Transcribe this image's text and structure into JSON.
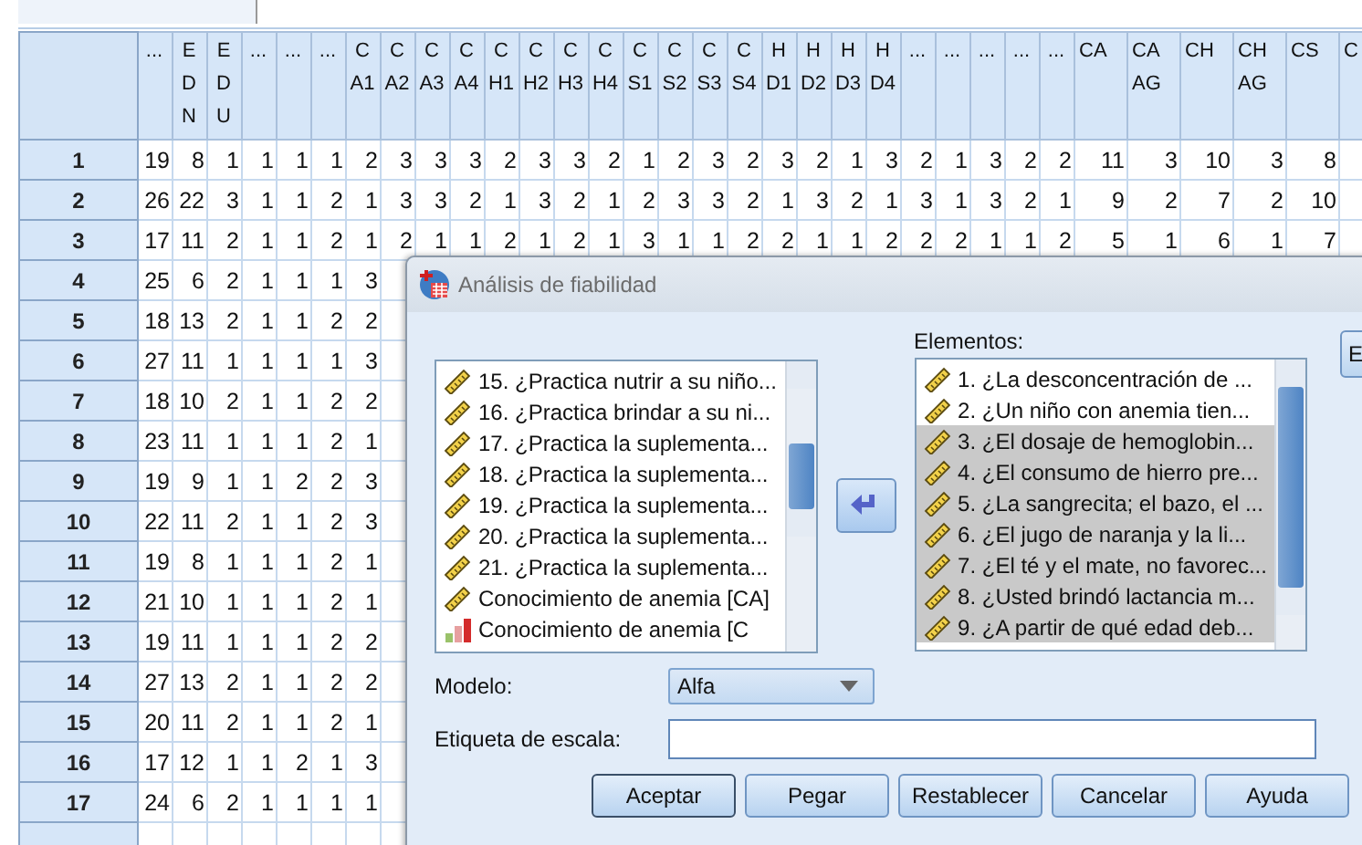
{
  "grid": {
    "columns": [
      {
        "label": "...",
        "kind": "narrow"
      },
      {
        "label": "EDN",
        "kind": "narrow"
      },
      {
        "label": "EDU",
        "kind": "narrow"
      },
      {
        "label": "...",
        "kind": "narrow"
      },
      {
        "label": "...",
        "kind": "narrow"
      },
      {
        "label": "...",
        "kind": "narrow"
      },
      {
        "label": "CA1",
        "kind": "narrow"
      },
      {
        "label": "CA2",
        "kind": "narrow"
      },
      {
        "label": "CA3",
        "kind": "narrow"
      },
      {
        "label": "CA4",
        "kind": "narrow"
      },
      {
        "label": "CH1",
        "kind": "narrow"
      },
      {
        "label": "CH2",
        "kind": "narrow"
      },
      {
        "label": "CH3",
        "kind": "narrow"
      },
      {
        "label": "CH4",
        "kind": "narrow"
      },
      {
        "label": "CS1",
        "kind": "narrow"
      },
      {
        "label": "CS2",
        "kind": "narrow"
      },
      {
        "label": "CS3",
        "kind": "narrow"
      },
      {
        "label": "CS4",
        "kind": "narrow"
      },
      {
        "label": "HD1",
        "kind": "narrow"
      },
      {
        "label": "HD2",
        "kind": "narrow"
      },
      {
        "label": "HD3",
        "kind": "narrow"
      },
      {
        "label": "HD4",
        "kind": "narrow"
      },
      {
        "label": "...",
        "kind": "narrow"
      },
      {
        "label": "...",
        "kind": "narrow"
      },
      {
        "label": "...",
        "kind": "narrow"
      },
      {
        "label": "...",
        "kind": "narrow"
      },
      {
        "label": "...",
        "kind": "narrow"
      },
      {
        "label": "CA",
        "kind": "wide"
      },
      {
        "label": "CAAG",
        "kind": "wide"
      },
      {
        "label": "CH",
        "kind": "wide"
      },
      {
        "label": "CHAG",
        "kind": "wide"
      },
      {
        "label": "CS",
        "kind": "wide"
      },
      {
        "label": "C",
        "kind": "wide"
      }
    ],
    "rows": [
      {
        "number": "1",
        "values": [
          "19",
          "8",
          "1",
          "1",
          "1",
          "1",
          "2",
          "3",
          "3",
          "3",
          "2",
          "3",
          "3",
          "2",
          "1",
          "2",
          "3",
          "2",
          "3",
          "2",
          "1",
          "3",
          "2",
          "1",
          "3",
          "2",
          "2",
          "11",
          "3",
          "10",
          "3",
          "8"
        ]
      },
      {
        "number": "2",
        "values": [
          "26",
          "22",
          "3",
          "1",
          "1",
          "2",
          "1",
          "3",
          "3",
          "2",
          "1",
          "3",
          "2",
          "1",
          "2",
          "3",
          "3",
          "2",
          "1",
          "3",
          "2",
          "1",
          "3",
          "1",
          "3",
          "2",
          "1",
          "9",
          "2",
          "7",
          "2",
          "10"
        ]
      },
      {
        "number": "3",
        "values": [
          "17",
          "11",
          "2",
          "1",
          "1",
          "2",
          "1",
          "2",
          "1",
          "1",
          "2",
          "1",
          "2",
          "1",
          "3",
          "1",
          "1",
          "2",
          "2",
          "1",
          "1",
          "2",
          "2",
          "2",
          "1",
          "1",
          "2",
          "5",
          "1",
          "6",
          "1",
          "7"
        ]
      },
      {
        "number": "4",
        "values": [
          "25",
          "6",
          "2",
          "1",
          "1",
          "1",
          "3"
        ]
      },
      {
        "number": "5",
        "values": [
          "18",
          "13",
          "2",
          "1",
          "1",
          "2",
          "2"
        ]
      },
      {
        "number": "6",
        "values": [
          "27",
          "11",
          "1",
          "1",
          "1",
          "1",
          "3"
        ]
      },
      {
        "number": "7",
        "values": [
          "18",
          "10",
          "2",
          "1",
          "1",
          "2",
          "2"
        ]
      },
      {
        "number": "8",
        "values": [
          "23",
          "11",
          "1",
          "1",
          "1",
          "2",
          "1"
        ]
      },
      {
        "number": "9",
        "values": [
          "19",
          "9",
          "1",
          "1",
          "2",
          "2",
          "3"
        ]
      },
      {
        "number": "10",
        "values": [
          "22",
          "11",
          "2",
          "1",
          "1",
          "2",
          "3"
        ]
      },
      {
        "number": "11",
        "values": [
          "19",
          "8",
          "1",
          "1",
          "1",
          "2",
          "1"
        ]
      },
      {
        "number": "12",
        "values": [
          "21",
          "10",
          "1",
          "1",
          "1",
          "2",
          "1"
        ]
      },
      {
        "number": "13",
        "values": [
          "19",
          "11",
          "1",
          "1",
          "1",
          "2",
          "2"
        ]
      },
      {
        "number": "14",
        "values": [
          "27",
          "13",
          "2",
          "1",
          "1",
          "2",
          "2"
        ]
      },
      {
        "number": "15",
        "values": [
          "20",
          "11",
          "2",
          "1",
          "1",
          "2",
          "1"
        ]
      },
      {
        "number": "16",
        "values": [
          "17",
          "12",
          "1",
          "1",
          "2",
          "1",
          "3"
        ]
      },
      {
        "number": "17",
        "values": [
          "24",
          "6",
          "2",
          "1",
          "1",
          "1",
          "1"
        ]
      }
    ]
  },
  "dialog": {
    "title": "Análisis de fiabilidad",
    "variables": [
      {
        "label": "15. ¿Practica nutrir a su niño...",
        "kind": "scale",
        "selected": false
      },
      {
        "label": "16. ¿Practica brindar a su ni...",
        "kind": "scale",
        "selected": false
      },
      {
        "label": "17. ¿Practica la suplementa...",
        "kind": "scale",
        "selected": false
      },
      {
        "label": "18. ¿Practica la suplementa...",
        "kind": "scale",
        "selected": false
      },
      {
        "label": "19. ¿Practica la suplementa...",
        "kind": "scale",
        "selected": false
      },
      {
        "label": "20. ¿Practica la suplementa...",
        "kind": "scale",
        "selected": false
      },
      {
        "label": "21. ¿Practica la suplementa...",
        "kind": "scale",
        "selected": false
      },
      {
        "label": "Conocimiento de anemia [CA]",
        "kind": "scale",
        "selected": false
      },
      {
        "label": "Conocimiento de anemia [C",
        "kind": "ordinal",
        "selected": false
      }
    ],
    "items_label": "Elementos:",
    "items": [
      {
        "label": "1. ¿La desconcentración de ...",
        "kind": "scale",
        "selected": false
      },
      {
        "label": "2. ¿Un niño con anemia tien...",
        "kind": "scale",
        "selected": false
      },
      {
        "label": "3. ¿El dosaje de hemoglobin...",
        "kind": "scale",
        "selected": true
      },
      {
        "label": "4. ¿El consumo de hierro pre...",
        "kind": "scale",
        "selected": true
      },
      {
        "label": "5. ¿La sangrecita; el bazo, el ...",
        "kind": "scale",
        "selected": true
      },
      {
        "label": "6. ¿El jugo de naranja y la li...",
        "kind": "scale",
        "selected": true
      },
      {
        "label": "7. ¿El té y el mate, no favorec...",
        "kind": "scale",
        "selected": true
      },
      {
        "label": "8. ¿Usted brindó lactancia m...",
        "kind": "scale",
        "selected": true
      },
      {
        "label": "9. ¿A partir de qué edad deb...",
        "kind": "scale",
        "selected": true
      }
    ],
    "side_button": "E",
    "model_label": "Modelo:",
    "model_value": "Alfa",
    "scale_label": "Etiqueta de escala:",
    "buttons": [
      {
        "label": "Aceptar",
        "default": true
      },
      {
        "label": "Pegar",
        "default": false
      },
      {
        "label": "Restablecer",
        "default": false
      },
      {
        "label": "Cancelar",
        "default": false
      },
      {
        "label": "Ayuda",
        "default": false
      }
    ]
  }
}
